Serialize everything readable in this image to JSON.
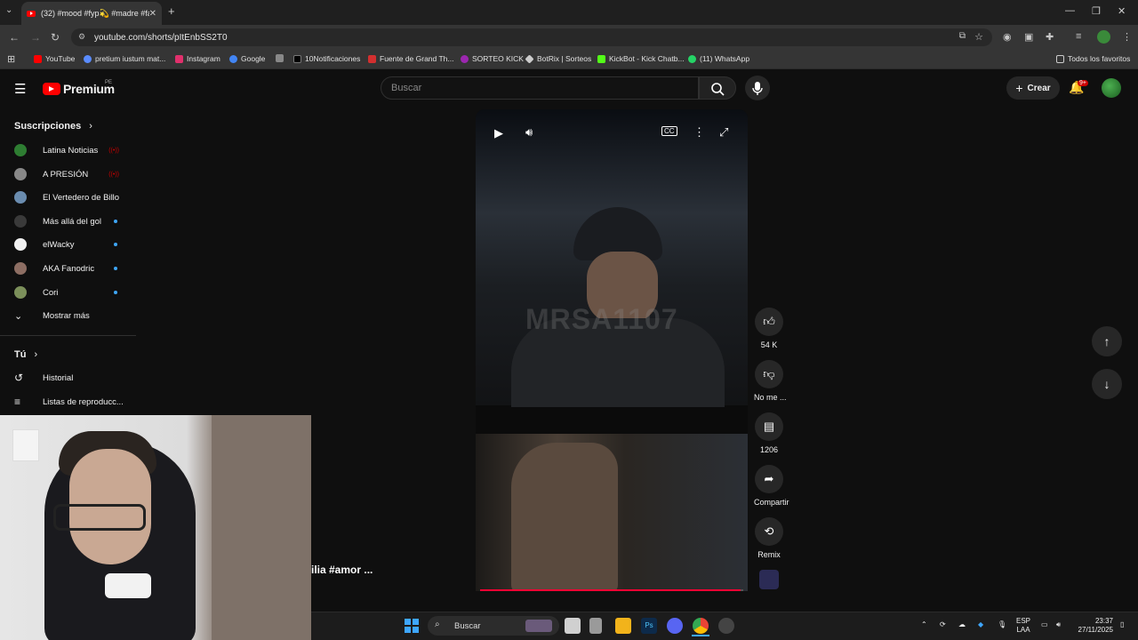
{
  "browser": {
    "tab_title": "(32) #mood #fyp💫 #madre #fa",
    "url": "youtube.com/shorts/pItEnbSS2T0",
    "bookmarks": [
      {
        "label": "YouTube",
        "color": "#ff0000"
      },
      {
        "label": "pretium iustum mat...",
        "color": "#5a8cff"
      },
      {
        "label": "Instagram",
        "color": "#e1306c"
      },
      {
        "label": "Google",
        "color": "#4285f4"
      },
      {
        "label": "",
        "color": "#888888"
      },
      {
        "label": "10Notificaciones",
        "color": "#000000"
      },
      {
        "label": "Fuente de Grand Th...",
        "color": "#d32f2f"
      },
      {
        "label": "SORTEO KICK",
        "color": "#9c27b0"
      },
      {
        "label": "BotRix | Sorteos",
        "color": "#cccccc"
      },
      {
        "label": "KickBot - Kick Chatb...",
        "color": "#53fc18"
      },
      {
        "label": "(11) WhatsApp",
        "color": "#25d366"
      }
    ],
    "all_bookmarks": "Todos los favoritos"
  },
  "youtube": {
    "brand": "Premium",
    "region": "PE",
    "search_placeholder": "Buscar",
    "create_label": "Crear",
    "notif_count": "9+"
  },
  "sidebar": {
    "subs_header": "Suscripciones",
    "subscriptions": [
      {
        "label": "Latina Noticias",
        "color": "#2e7d32",
        "status": "live"
      },
      {
        "label": "A PRESIÓN",
        "color": "#888888",
        "status": "live"
      },
      {
        "label": "El Vertedero de Billo",
        "color": "#6a8caf",
        "status": "none"
      },
      {
        "label": "Más allá del gol",
        "color": "#3a3a3a",
        "status": "dot"
      },
      {
        "label": "elWacky",
        "color": "#f1f1f1",
        "status": "dot"
      },
      {
        "label": "AKA Fanodric",
        "color": "#8d6e63",
        "status": "dot"
      },
      {
        "label": "Cori",
        "color": "#7b8f5a",
        "status": "dot"
      }
    ],
    "show_more": "Mostrar más",
    "you_header": "Tú",
    "history": "Historial",
    "playlists": "Listas de reproducc..."
  },
  "short": {
    "watermark": "MRSA1107",
    "title_fragment": "ilia #amor ...",
    "likes": "54 K",
    "dislike_label": "No me ...",
    "comments": "1206",
    "share_label": "Compartir",
    "remix_label": "Remix",
    "progress": 0.99
  },
  "taskbar": {
    "search_label": "Buscar",
    "lang": "ESP",
    "lang_sub": "LAA",
    "time": "23:37",
    "date": "27/11/2025"
  }
}
